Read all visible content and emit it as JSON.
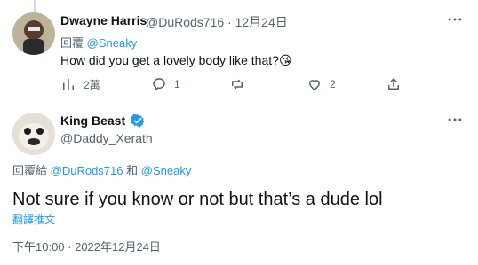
{
  "reply": {
    "author_name": "Dwayne Harris",
    "handle_date": "@DuRods716 · 12月24日",
    "replying_label": "回覆",
    "replying_to": "@Sneaky",
    "text": "How did you get a lovely body like that?",
    "emoji": "😘",
    "views": "2萬",
    "replies": "1",
    "retweets": "",
    "likes": "2"
  },
  "main": {
    "author_name": "King Beast",
    "handle": "@Daddy_Xerath",
    "replying_label": "回覆給",
    "replying_to_1": "@DuRods716",
    "and_label": "和",
    "replying_to_2": "@Sneaky",
    "text": "Not sure if you know or not but that’s a dude lol",
    "translate": "翻譯推文",
    "timestamp": "下午10:00 · 2022年12月24日"
  },
  "colors": {
    "accent": "#1d9bf0",
    "muted": "#536471",
    "text": "#0f1419"
  }
}
